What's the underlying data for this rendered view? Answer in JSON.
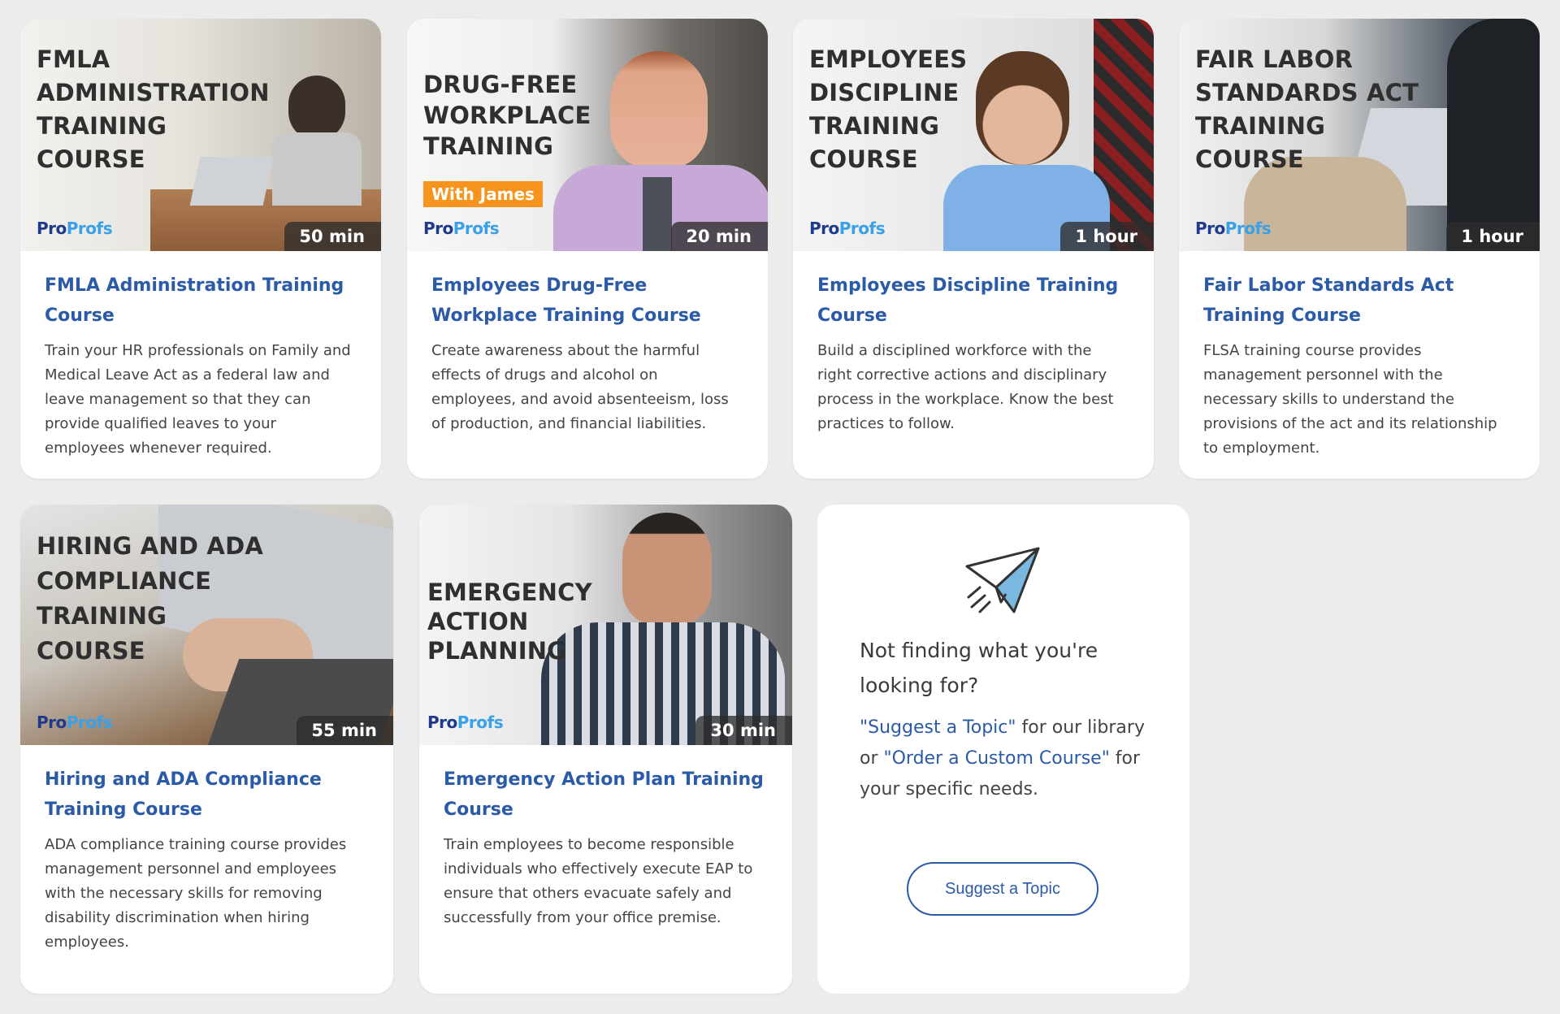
{
  "brand": {
    "part1": "Pro",
    "part2": "Profs"
  },
  "courses": [
    {
      "thumb_title": "FMLA\nADMINISTRATION\nTRAINING\nCOURSE",
      "duration": "50 min",
      "title": "FMLA Administration Training Course",
      "description": "Train your HR professionals on Family and Medical Leave Act as a federal law and leave management so that they can provide qualified leaves to your employees whenever required."
    },
    {
      "thumb_title": "DRUG-FREE\nWORKPLACE\nTRAINING",
      "tag": "With James",
      "duration": "20 min",
      "title": "Employees Drug-Free Workplace Training Course",
      "description": "Create awareness about the harmful effects of drugs and alcohol on employees, and avoid absenteeism, loss of production, and financial liabilities."
    },
    {
      "thumb_title": "EMPLOYEES\nDISCIPLINE\nTRAINING\nCOURSE",
      "duration": "1 hour",
      "title": "Employees Discipline Training Course",
      "description": "Build a disciplined workforce with the right corrective actions and disciplinary process in the workplace. Know the best practices to follow."
    },
    {
      "thumb_title": "FAIR LABOR\nSTANDARDS ACT\nTRAINING\nCOURSE",
      "duration": "1 hour",
      "title": "Fair Labor Standards Act Training Course",
      "description": "FLSA training course provides management personnel with the necessary skills to understand the provisions of the act and its relationship to employment."
    },
    {
      "thumb_title": "HIRING AND ADA\nCOMPLIANCE\nTRAINING\nCOURSE",
      "duration": "55 min",
      "title": "Hiring and ADA Compliance Training Course",
      "description": "ADA compliance training course provides management personnel and employees with the necessary skills for removing disability discrimination when hiring employees."
    },
    {
      "thumb_title": "EMERGENCY\nACTION\nPLANNING",
      "duration": "30 min",
      "title": "Emergency Action Plan Training Course",
      "description": "Train employees to become responsible individuals who effectively execute EAP to ensure that others evacuate safely and successfully from your office premise."
    }
  ],
  "cta": {
    "icon": "paper-plane-icon",
    "heading": "Not finding what you're looking for?",
    "suggest_link": "\"Suggest a Topic\"",
    "text_middle": " for our library or ",
    "order_link": "\"Order a Custom Course\"",
    "text_end": " for your specific needs.",
    "button_label": "Suggest a Topic"
  },
  "colors": {
    "page_bg": "#ececec",
    "title_blue": "#2b5aa6",
    "tag_orange": "#f7941d",
    "brand_dark": "#1f3a8a",
    "brand_light": "#3aa0e8"
  }
}
